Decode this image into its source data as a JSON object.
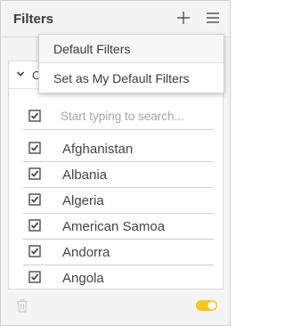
{
  "panel": {
    "title": "Filters",
    "icons": {
      "add": "plus-icon",
      "menu": "hamburger-menu-icon"
    }
  },
  "dropdown": {
    "items": [
      "Default Filters",
      "Set as My Default Filters"
    ]
  },
  "group": {
    "initial": "C",
    "expanded": true
  },
  "search": {
    "placeholder": "Start typing to search..."
  },
  "countries": [
    {
      "label": "Afghanistan",
      "checked": true
    },
    {
      "label": "Albania",
      "checked": true
    },
    {
      "label": "Algeria",
      "checked": true
    },
    {
      "label": "American Samoa",
      "checked": true
    },
    {
      "label": "Andorra",
      "checked": true
    },
    {
      "label": "Angola",
      "checked": true
    }
  ],
  "footer": {
    "toggle_on": true
  },
  "colors": {
    "checkbox": "#4a4a4a",
    "toggle": "#f5c518"
  }
}
